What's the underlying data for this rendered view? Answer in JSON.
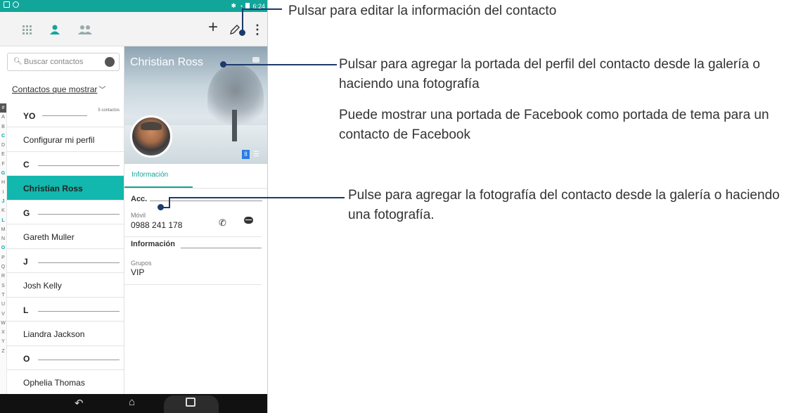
{
  "status_bar": {
    "time": "6:24"
  },
  "search": {
    "placeholder": "Buscar contactos"
  },
  "filter_label": "Contactos que mostrar",
  "alphabet": [
    "#",
    "A",
    "B",
    "C",
    "D",
    "E",
    "F",
    "G",
    "H",
    "I",
    "J",
    "K",
    "L",
    "M",
    "N",
    "O",
    "P",
    "Q",
    "R",
    "S",
    "T",
    "U",
    "V",
    "W",
    "X",
    "Y",
    "Z"
  ],
  "contact_list": {
    "me_header": "YO",
    "me_count": "5 contactos",
    "configure_profile": "Configurar mi perfil",
    "rows": [
      {
        "type": "header",
        "label": "C"
      },
      {
        "type": "contact",
        "label": "Christian Ross",
        "selected": true
      },
      {
        "type": "header",
        "label": "G"
      },
      {
        "type": "contact",
        "label": "Gareth Muller"
      },
      {
        "type": "header",
        "label": "J"
      },
      {
        "type": "contact",
        "label": "Josh Kelly"
      },
      {
        "type": "header",
        "label": "L"
      },
      {
        "type": "contact",
        "label": "Liandra Jackson"
      },
      {
        "type": "header",
        "label": "O"
      },
      {
        "type": "contact",
        "label": "Ophelia Thomas"
      }
    ]
  },
  "detail": {
    "name": "Christian Ross",
    "tab_label": "Información",
    "account_header": "Acc.",
    "phone_label": "Móvil",
    "phone_number": "0988 241 178",
    "info_header": "Información",
    "groups_label": "Grupos",
    "groups_value": "VIP",
    "google_badge": "8"
  },
  "callouts": {
    "edit": "Pulsar para editar la información del contacto",
    "cover": "Pulsar para agregar la portada del perfil del contacto desde la galería o haciendo una fotografía",
    "facebook": "Puede mostrar una portada de Facebook como portada de tema para un contacto de Facebook",
    "photo": "Pulse para agregar la fotografía del contacto desde la galería o haciendo una fotografía."
  },
  "colors": {
    "accent": "#12a59a",
    "selected_row": "#12b7ad",
    "callout_line": "#1c3b6a"
  }
}
